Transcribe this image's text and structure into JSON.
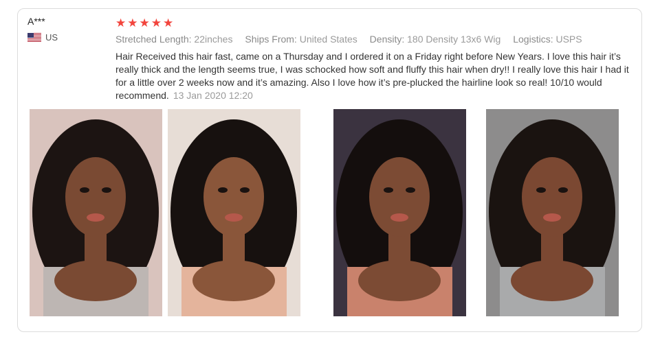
{
  "review": {
    "reviewer": "A***",
    "country": "US",
    "rating": 5,
    "meta": [
      {
        "key": "Stretched Length:",
        "value": "22inches"
      },
      {
        "key": "Ships From:",
        "value": "United States"
      },
      {
        "key": "Density:",
        "value": "180 Density 13x6 Wig"
      },
      {
        "key": "Logistics:",
        "value": "USPS"
      }
    ],
    "text": "Hair Received this hair fast, came on a Thursday and I ordered it on a Friday right before New Years. I love this hair it’s really thick and the length seems true, I was schocked how soft and fluffy this hair when dry!! I really love this hair I had it for a little over 2 weeks now and it’s amazing. Also I love how it’s pre-plucked the hairline look so real! 10/10 would recommend.",
    "date": "13 Jan 2020 12:20",
    "colors": {
      "star": "#f2453d",
      "meta": "#9a9a9a"
    },
    "photos": [
      {
        "icon": "review-photo",
        "bg": "#d9c3bd",
        "skin": "#7a4a33",
        "hair": "#1c1412",
        "top": "#bdb6b3"
      },
      {
        "icon": "review-photo",
        "bg": "#e7ddd6",
        "skin": "#8a563a",
        "hair": "#17110f",
        "top": "#e4b49c"
      },
      {
        "icon": "review-photo",
        "bg": "#3b3340",
        "skin": "#7c4b34",
        "hair": "#140e0d",
        "top": "#c9826c"
      },
      {
        "icon": "review-photo",
        "bg": "#8d8c8c",
        "skin": "#7b4832",
        "hair": "#1a1310",
        "top": "#a9aaab"
      }
    ]
  }
}
